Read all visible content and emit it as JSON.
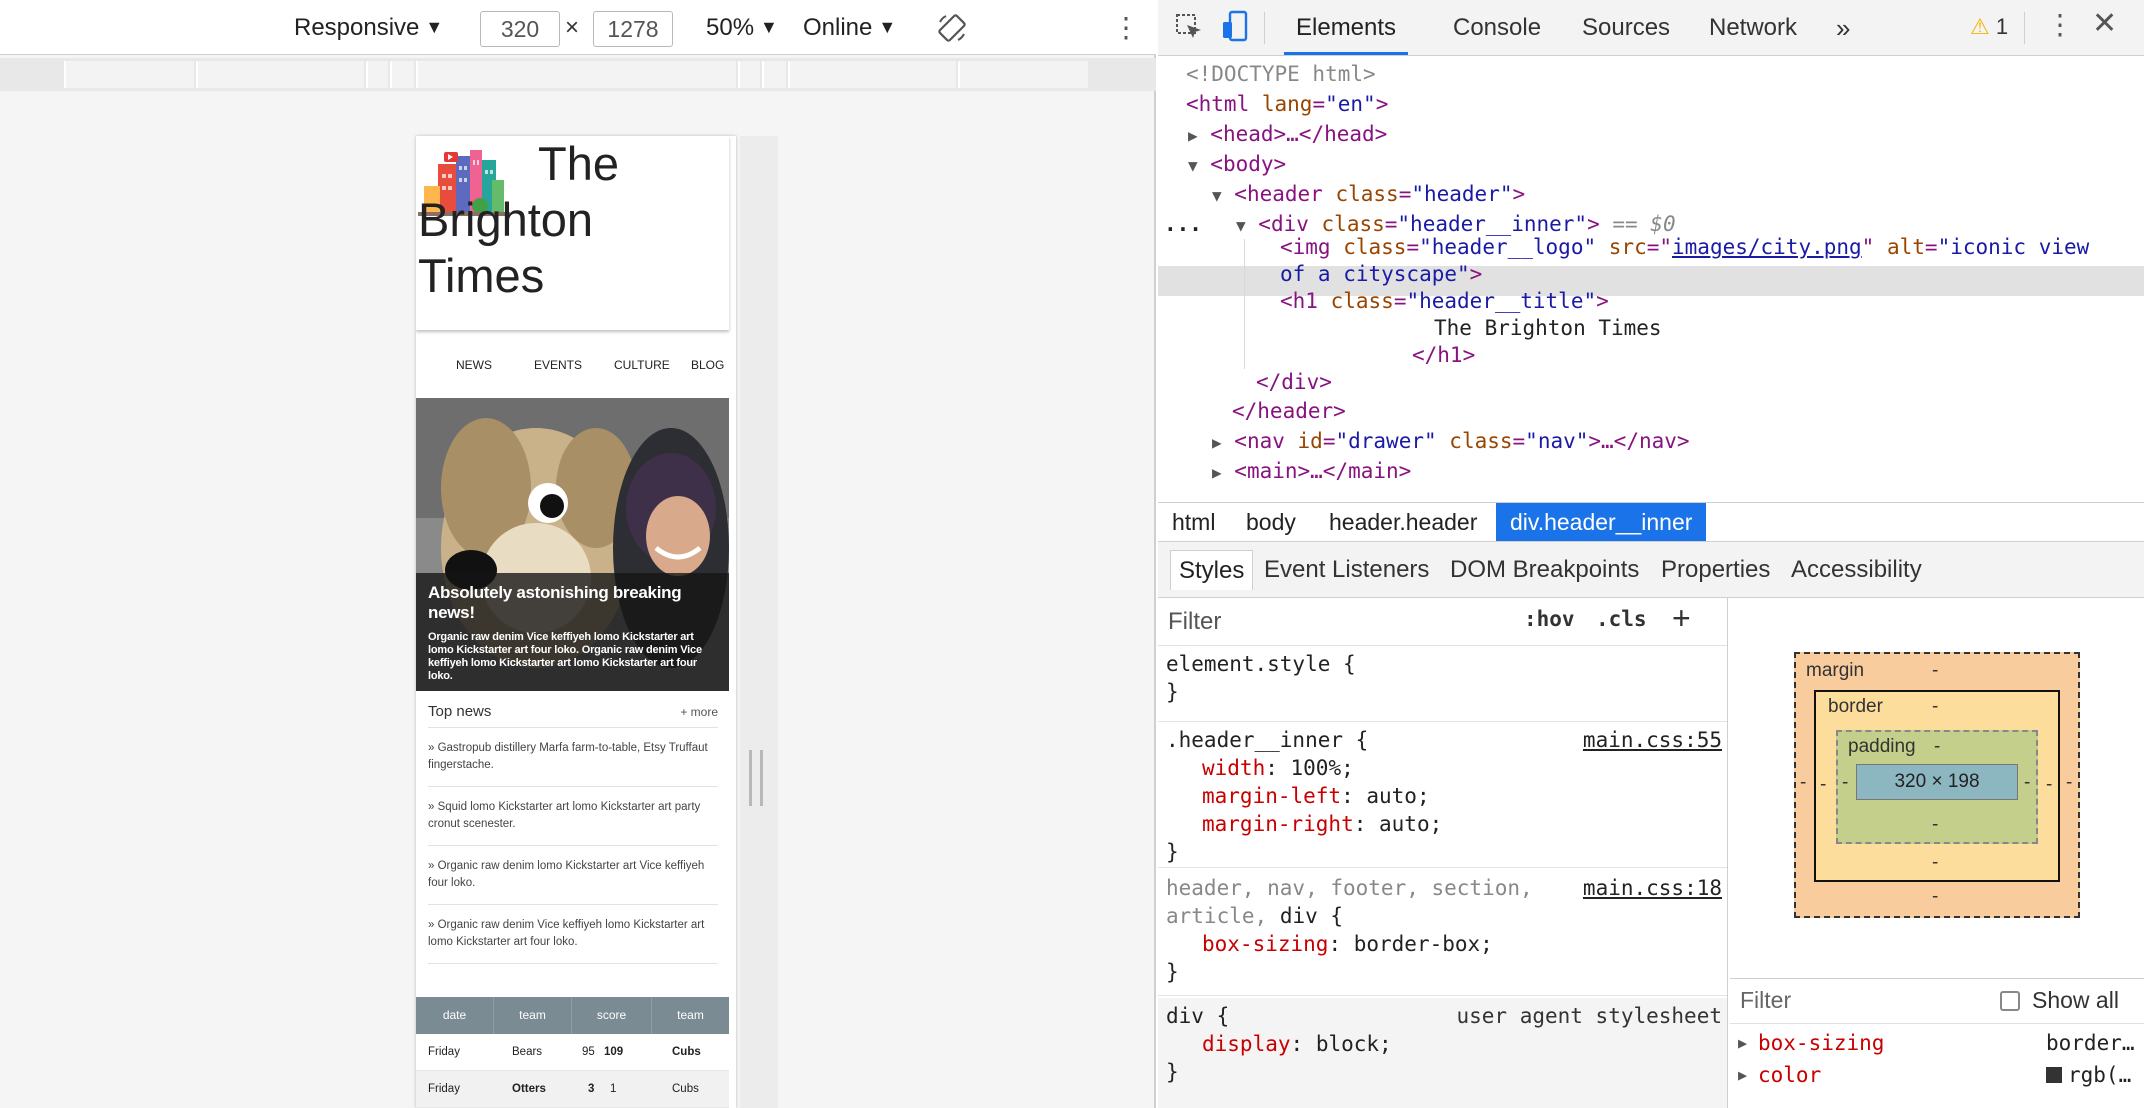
{
  "device_toolbar": {
    "mode": "Responsive",
    "width": "320",
    "height": "1278",
    "times": "×",
    "zoom": "50%",
    "throttle": "Online"
  },
  "emulated_site": {
    "title_line1": "The",
    "title_line2": "Brighton",
    "title_line3": "Times",
    "nav": [
      "NEWS",
      "EVENTS",
      "CULTURE",
      "BLOG"
    ],
    "hero_headline": "Absolutely astonishing breaking news!",
    "hero_body": "Organic raw denim Vice keffiyeh lomo Kickstarter art lomo Kickstarter art four loko. Organic raw denim Vice keffiyeh lomo Kickstarter art lomo Kickstarter art four loko.",
    "top_news_title": "Top news",
    "top_news_more": "+ more",
    "top_news_items": [
      "»   Gastropub distillery Marfa farm-to-table, Etsy Truffaut fingerstache.",
      "»   Squid lomo Kickstarter art lomo Kickstarter art party cronut scenester.",
      "»   Organic raw denim lomo Kickstarter art Vice keffiyeh four loko.",
      "»   Organic raw denim Vice keffiyeh lomo Kickstarter art lomo Kickstarter art four loko."
    ],
    "scores_headers": [
      "date",
      "team",
      "score",
      "team"
    ],
    "scores_rows": [
      {
        "date": "Friday",
        "team1": "Bears",
        "s1": "95",
        "s2": "109",
        "team2": "Cubs"
      },
      {
        "date": "Friday",
        "team1": "Otters",
        "s1": "3",
        "s2": "1",
        "team2": "Cubs"
      }
    ]
  },
  "devtools": {
    "tabs": [
      "Elements",
      "Console",
      "Sources",
      "Network"
    ],
    "more_tabs": "»",
    "warning_count": "1",
    "tree": {
      "doctype": "<!DOCTYPE html>",
      "html_open": "<html",
      "lang_attr": "lang",
      "lang_val": "\"en\"",
      "head": "<head>…</head>",
      "body_open": "<body>",
      "header_tag": "<header",
      "header_class_val": "\"header\"",
      "div_tag": "<div",
      "div_class_val": "\"header__inner\"",
      "selected_marker": "== $0",
      "img_tag": "<img",
      "img_class_val": "\"header__logo\"",
      "img_src_val": "images/city.png",
      "img_alt_val_1": "\"iconic view",
      "img_alt_val_2": "of a cityscape\"",
      "h1_tag": "<h1",
      "h1_class_val": "\"header__title\"",
      "h1_text": "The Brighton Times",
      "h1_close": "</h1>",
      "div_close": "</div>",
      "header_close": "</header>",
      "nav_tag": "<nav",
      "nav_id_val": "\"drawer\"",
      "nav_class_val": "\"nav\"",
      "nav_rest": ">…</nav>",
      "main_line": "<main>…</main>",
      "ellipsis": "..."
    },
    "breadcrumbs": [
      "html",
      "body",
      "header.header",
      "div.header__inner"
    ],
    "styles_tabs": [
      "Styles",
      "Event Listeners",
      "DOM Breakpoints",
      "Properties",
      "Accessibility"
    ],
    "filter_placeholder": "Filter",
    "hov": ":hov",
    "cls": ".cls",
    "rules": [
      {
        "selector": "element.style {",
        "source": ""
      },
      {
        "selector": ".header__inner {",
        "source": "main.css:55"
      },
      {
        "selector": "div {",
        "source": "user agent stylesheet"
      }
    ],
    "rule_close": "}",
    "width_name": "width",
    "width_val": "100%;",
    "ml_name": "margin-left",
    "ml_val": "auto;",
    "mr_name": "margin-right",
    "mr_val": "auto;",
    "group_selector_gray": "header, nav, footer, section,",
    "group_selector_gray2": "article,",
    "group_selector_dark": "div {",
    "group_source": "main.css:18",
    "bs_name": "box-sizing",
    "bs_val": "border-box;",
    "disp_name": "display",
    "disp_val": "block;",
    "boxmodel": {
      "margin": "margin",
      "border": "border",
      "padding": "padding",
      "dash": "-",
      "content": "320 × 198"
    },
    "computed_filter": "Filter",
    "show_all": "Show all",
    "computed": [
      {
        "name": "box-sizing",
        "value": "border…"
      },
      {
        "name": "color",
        "value": "rgb(…"
      }
    ]
  }
}
